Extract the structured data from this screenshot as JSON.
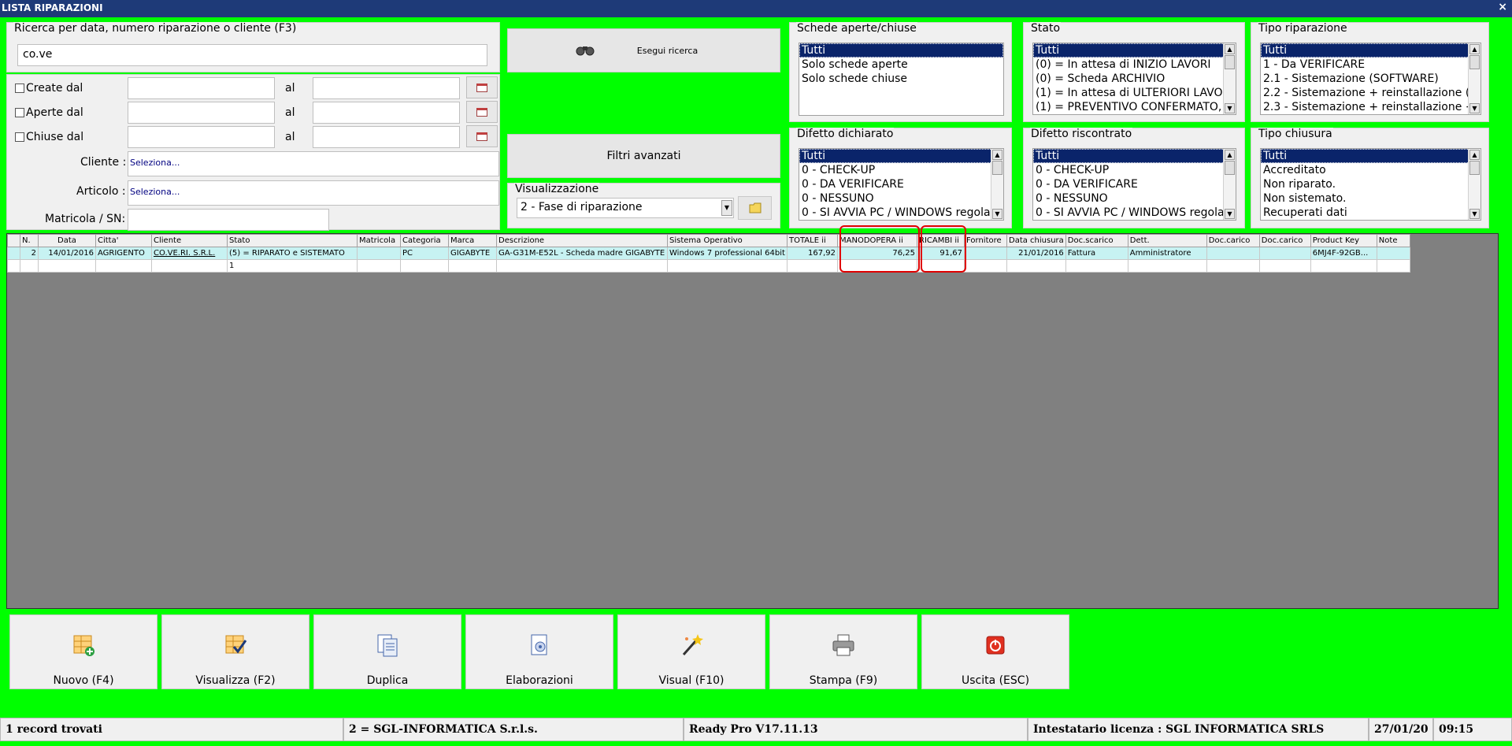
{
  "window": {
    "title": "LISTA RIPARAZIONI",
    "close": "×"
  },
  "search": {
    "group_title": "Ricerca per data, numero riparazione o cliente (F3)",
    "value": "co.ve",
    "created_label": "Create dal",
    "opened_label": "Aperte dal",
    "closed_label": "Chiuse dal",
    "al_label": "al",
    "cliente_label": "Cliente :",
    "cliente_value": "Seleziona...",
    "articolo_label": "Articolo :",
    "articolo_value": "Seleziona...",
    "matricola_label": "Matricola / SN:"
  },
  "actions": {
    "esegui": "Esegui ricerca",
    "filtri": "Filtri avanzati",
    "visualizzazione_title": "Visualizzazione",
    "visualizzazione_value": "2 - Fase di riparazione"
  },
  "filters": {
    "schede": {
      "title": "Schede aperte/chiuse",
      "items": [
        "Tutti",
        "Solo schede aperte",
        "Solo schede chiuse"
      ]
    },
    "stato": {
      "title": "Stato",
      "items": [
        "Tutti",
        "(0) = In attesa di INIZIO LAVORI",
        "(0) = Scheda ARCHIVIO",
        "(1) = In attesa di ULTERIORI LAVO",
        "(1) = PREVENTIVO CONFERMATO,"
      ]
    },
    "tipo_riparazione": {
      "title": "Tipo riparazione",
      "items": [
        "Tutti",
        "1 - Da VERIFICARE",
        "2.1 - Sistemazione (SOFTWARE)",
        "2.2 - Sistemazione + reinstallazione (SOF",
        "2.3 - Sistemazione + reinstallazione + rec"
      ]
    },
    "difetto_dichiarato": {
      "title": "Difetto dichiarato",
      "items": [
        "Tutti",
        "0 - CHECK-UP",
        "0 - DA VERIFICARE",
        "0 - NESSUNO",
        "0 - SI AVVIA PC / WINDOWS regola"
      ]
    },
    "difetto_riscontrato": {
      "title": "Difetto riscontrato",
      "items": [
        "Tutti",
        "0 - CHECK-UP",
        "0 - DA VERIFICARE",
        "0 - NESSUNO",
        "0 - SI AVVIA PC / WINDOWS regola"
      ]
    },
    "tipo_chiusura": {
      "title": "Tipo chiusura",
      "items": [
        "Tutti",
        "Accreditato",
        "Non riparato.",
        "Non sistemato.",
        "Recuperati dati"
      ]
    }
  },
  "grid": {
    "columns": [
      "N.",
      "Data",
      "Citta'",
      "Cliente",
      "Stato",
      "Matricola",
      "Categoria",
      "Marca",
      "Descrizione",
      "Sistema Operativo",
      "TOTALE ii",
      "MANODOPERA ii",
      "RICAMBI ii",
      "Fornitore",
      "Data chiusura",
      "Doc.scarico",
      "Dett.",
      "Doc.carico",
      "Doc.carico",
      "Product Key",
      "Note"
    ],
    "rows": [
      [
        "2",
        "14/01/2016",
        "AGRIGENTO",
        "CO.VE.RI. S.R.L.",
        "(5) = RIPARATO e SISTEMATO",
        "",
        "PC",
        "GIGABYTE",
        "GA-G31M-E52L - Scheda madre GIGABYTE",
        "Windows 7 professional 64bit",
        "167,92",
        "76,25",
        "91,67",
        "",
        "21/01/2016",
        "Fattura",
        "Amministratore",
        "",
        "",
        "6MJ4F-92GB...",
        ""
      ],
      [
        "",
        "",
        "",
        "",
        "1",
        "",
        "",
        "",
        "",
        "",
        "",
        "",
        "",
        "",
        "",
        "",
        "",
        "",
        "",
        "",
        ""
      ]
    ]
  },
  "buttons": [
    {
      "label": "Nuovo (F4)",
      "icon": "new-record-icon"
    },
    {
      "label": "Visualizza (F2)",
      "icon": "view-record-icon"
    },
    {
      "label": "Duplica",
      "icon": "duplicate-icon"
    },
    {
      "label": "Elaborazioni",
      "icon": "process-icon"
    },
    {
      "label": "Visual (F10)",
      "icon": "magic-wand-icon"
    },
    {
      "label": "Stampa (F9)",
      "icon": "printer-icon"
    },
    {
      "label": "Uscita (ESC)",
      "icon": "exit-icon"
    }
  ],
  "statusbar": {
    "records": "1 record trovati",
    "company": "2 = SGL-INFORMATICA S.r.l.s.",
    "version": "Ready Pro V17.11.13",
    "license": "Intestatario licenza : SGL INFORMATICA SRLS",
    "date": "27/01/20",
    "time": "09:15"
  }
}
